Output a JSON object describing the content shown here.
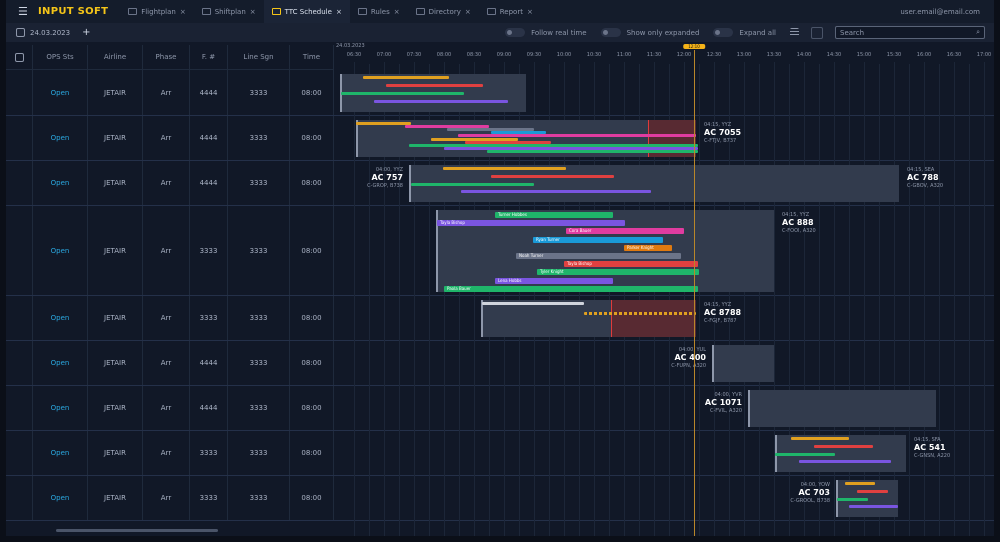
{
  "header": {
    "app_title": "INPUT SOFT",
    "tabs": [
      {
        "label": "Flightplan",
        "active": false
      },
      {
        "label": "Shiftplan",
        "active": false
      },
      {
        "label": "TTC Schedule",
        "active": true
      },
      {
        "label": "Rules",
        "active": false
      },
      {
        "label": "Directory",
        "active": false
      },
      {
        "label": "Report",
        "active": false
      }
    ],
    "user": "user.email@email.com"
  },
  "toolbar": {
    "date": "24.03.2023",
    "add": "+",
    "toggles": [
      "Follow real time",
      "Show only expanded",
      "Expand all"
    ],
    "search_placeholder": "Search",
    "search_icon": "⌕"
  },
  "table": {
    "columns": [
      "OPS Sts",
      "Airline",
      "Phase",
      "F. #",
      "Line Sgn",
      "Time"
    ],
    "rows": [
      [
        "Open",
        "JETAIR",
        "Arr",
        "4444",
        "3333",
        "08:00"
      ],
      [
        "Open",
        "JETAIR",
        "Arr",
        "4444",
        "3333",
        "08:00"
      ],
      [
        "Open",
        "JETAIR",
        "Arr",
        "4444",
        "3333",
        "08:00"
      ],
      [
        "Open",
        "JETAIR",
        "Arr",
        "3333",
        "3333",
        "08:00"
      ],
      [
        "Open",
        "JETAIR",
        "Arr",
        "3333",
        "3333",
        "08:00"
      ],
      [
        "Open",
        "JETAIR",
        "Arr",
        "4444",
        "3333",
        "08:00"
      ],
      [
        "Open",
        "JETAIR",
        "Arr",
        "4444",
        "3333",
        "08:00"
      ],
      [
        "Open",
        "JETAIR",
        "Arr",
        "3333",
        "3333",
        "08:00"
      ],
      [
        "Open",
        "JETAIR",
        "Arr",
        "3333",
        "3333",
        "08:00"
      ]
    ]
  },
  "timeline": {
    "date": "24.03.2023",
    "ticks": [
      "06:30",
      "07:00",
      "07:30",
      "08:00",
      "08:30",
      "09:00",
      "09:30",
      "10:00",
      "10:30",
      "11:00",
      "11:30",
      "12:00",
      "12:30",
      "13:00",
      "13:30",
      "14:00",
      "14:30",
      "15:00",
      "15:30",
      "16:00",
      "16:30",
      "17:00"
    ],
    "now": "12:10"
  },
  "colors": {
    "orange": "#e0a020",
    "red": "#e04040",
    "green": "#1fb56a",
    "purple": "#7a55e0",
    "pink": "#e03ca0",
    "blue": "#1a9ad8",
    "gray": "#6b7489",
    "white": "#d0d4dc",
    "dorange": "#e07a10"
  },
  "flights": [
    {
      "start": "06:16",
      "end": "09:22",
      "bars": [
        [
          "06:39",
          "08:05",
          "orange"
        ],
        [
          "07:02",
          "08:39",
          "red"
        ],
        [
          "06:17",
          "08:20",
          "green"
        ],
        [
          "06:50",
          "09:04",
          "purple"
        ]
      ]
    },
    {
      "start": "06:32",
      "end": "12:12",
      "delay": "11:24",
      "label": {
        "side": "right",
        "l1": "04:15, YYZ",
        "l2": "AC 7055",
        "l3": "C-FTJV, B737"
      },
      "bars": [
        [
          "06:32",
          "07:27",
          "orange"
        ],
        [
          "07:21",
          "08:45",
          "pink"
        ],
        [
          "08:03",
          "09:30",
          "gray"
        ],
        [
          "08:47",
          "09:42",
          "blue"
        ],
        [
          "08:14",
          "12:12",
          "pink"
        ],
        [
          "07:47",
          "09:14",
          "orange"
        ],
        [
          "08:21",
          "09:47",
          "red"
        ],
        [
          "07:25",
          "12:14",
          "green"
        ],
        [
          "08:00",
          "12:14",
          "purple"
        ],
        [
          "08:43",
          "12:14",
          "green"
        ]
      ]
    },
    {
      "start": "07:25",
      "end": "15:35",
      "label": {
        "side": "left",
        "l1": "04:00, YYZ",
        "l2": "AC 757",
        "l3": "C-GROP, B738"
      },
      "label2": {
        "side": "right",
        "l1": "04:15, SEA",
        "l2": "AC 788",
        "l3": "C-GBOV, A320"
      },
      "bars": [
        [
          "07:59",
          "10:02",
          "orange"
        ],
        [
          "08:47",
          "10:50",
          "red"
        ],
        [
          "07:27",
          "09:30",
          "green"
        ],
        [
          "08:17",
          "11:27",
          "purple"
        ]
      ]
    },
    {
      "start": "07:52",
      "end": "13:30",
      "label": {
        "side": "right",
        "l1": "04:15, YYZ",
        "l2": "AC 888",
        "l3": "C-FOOI, A320"
      },
      "lbars": [
        [
          "08:51",
          "10:49",
          "green",
          "Turner Hobbes"
        ],
        [
          "07:53",
          "11:01",
          "purple",
          "Tayla Bishop"
        ],
        [
          "10:02",
          "12:00",
          "pink",
          "Cora Bauer"
        ],
        [
          "09:29",
          "11:39",
          "blue",
          "Ryan Turner"
        ],
        [
          "11:00",
          "11:48",
          "dorange",
          "Parker Knight"
        ],
        [
          "09:12",
          "11:57",
          "gray",
          "Noah Turner"
        ],
        [
          "10:00",
          "12:14",
          "red",
          "Tayla Bishop"
        ],
        [
          "09:33",
          "12:15",
          "green",
          "Tyler Knight"
        ],
        [
          "08:51",
          "10:49",
          "purple",
          "Lena Hobbs"
        ],
        [
          "08:00",
          "12:14",
          "green",
          "Paola Bauer"
        ]
      ]
    },
    {
      "start": "08:37",
      "end": "12:12",
      "delay": "10:47",
      "label": {
        "side": "right",
        "l1": "04:15, YYZ",
        "l2": "AC 8788",
        "l3": "C-FGJF, B787"
      },
      "bars": [
        [
          "08:38",
          "10:20",
          "white"
        ]
      ],
      "dashed": [
        "10:20",
        "12:12",
        "orange"
      ]
    },
    {
      "start": "12:28",
      "end": "13:30",
      "label": {
        "side": "left",
        "l1": "04:00, YUL",
        "l2": "AC 400",
        "l3": "C-FUPN, A320"
      }
    },
    {
      "start": "13:04",
      "end": "16:12",
      "label": {
        "side": "left",
        "l1": "04:00, YVR",
        "l2": "AC 1071",
        "l3": "C-FVIL, A320"
      }
    },
    {
      "start": "13:31",
      "end": "15:42",
      "label": {
        "side": "right",
        "l1": "04:15, SFA",
        "l2": "AC 541",
        "l3": "C-GNSN, A220"
      },
      "bars": [
        [
          "13:47",
          "14:45",
          "orange"
        ],
        [
          "14:10",
          "15:09",
          "red"
        ],
        [
          "13:31",
          "14:31",
          "green"
        ],
        [
          "13:55",
          "15:27",
          "purple"
        ]
      ]
    },
    {
      "start": "14:32",
      "end": "15:34",
      "label": {
        "side": "left",
        "l1": "04:00, YOW",
        "l2": "AC 703",
        "l3": "C-GROOL, B738"
      },
      "bars": [
        [
          "14:41",
          "15:11",
          "orange"
        ],
        [
          "14:53",
          "15:24",
          "red"
        ],
        [
          "14:33",
          "15:04",
          "green"
        ],
        [
          "14:45",
          "15:34",
          "purple"
        ]
      ]
    }
  ]
}
